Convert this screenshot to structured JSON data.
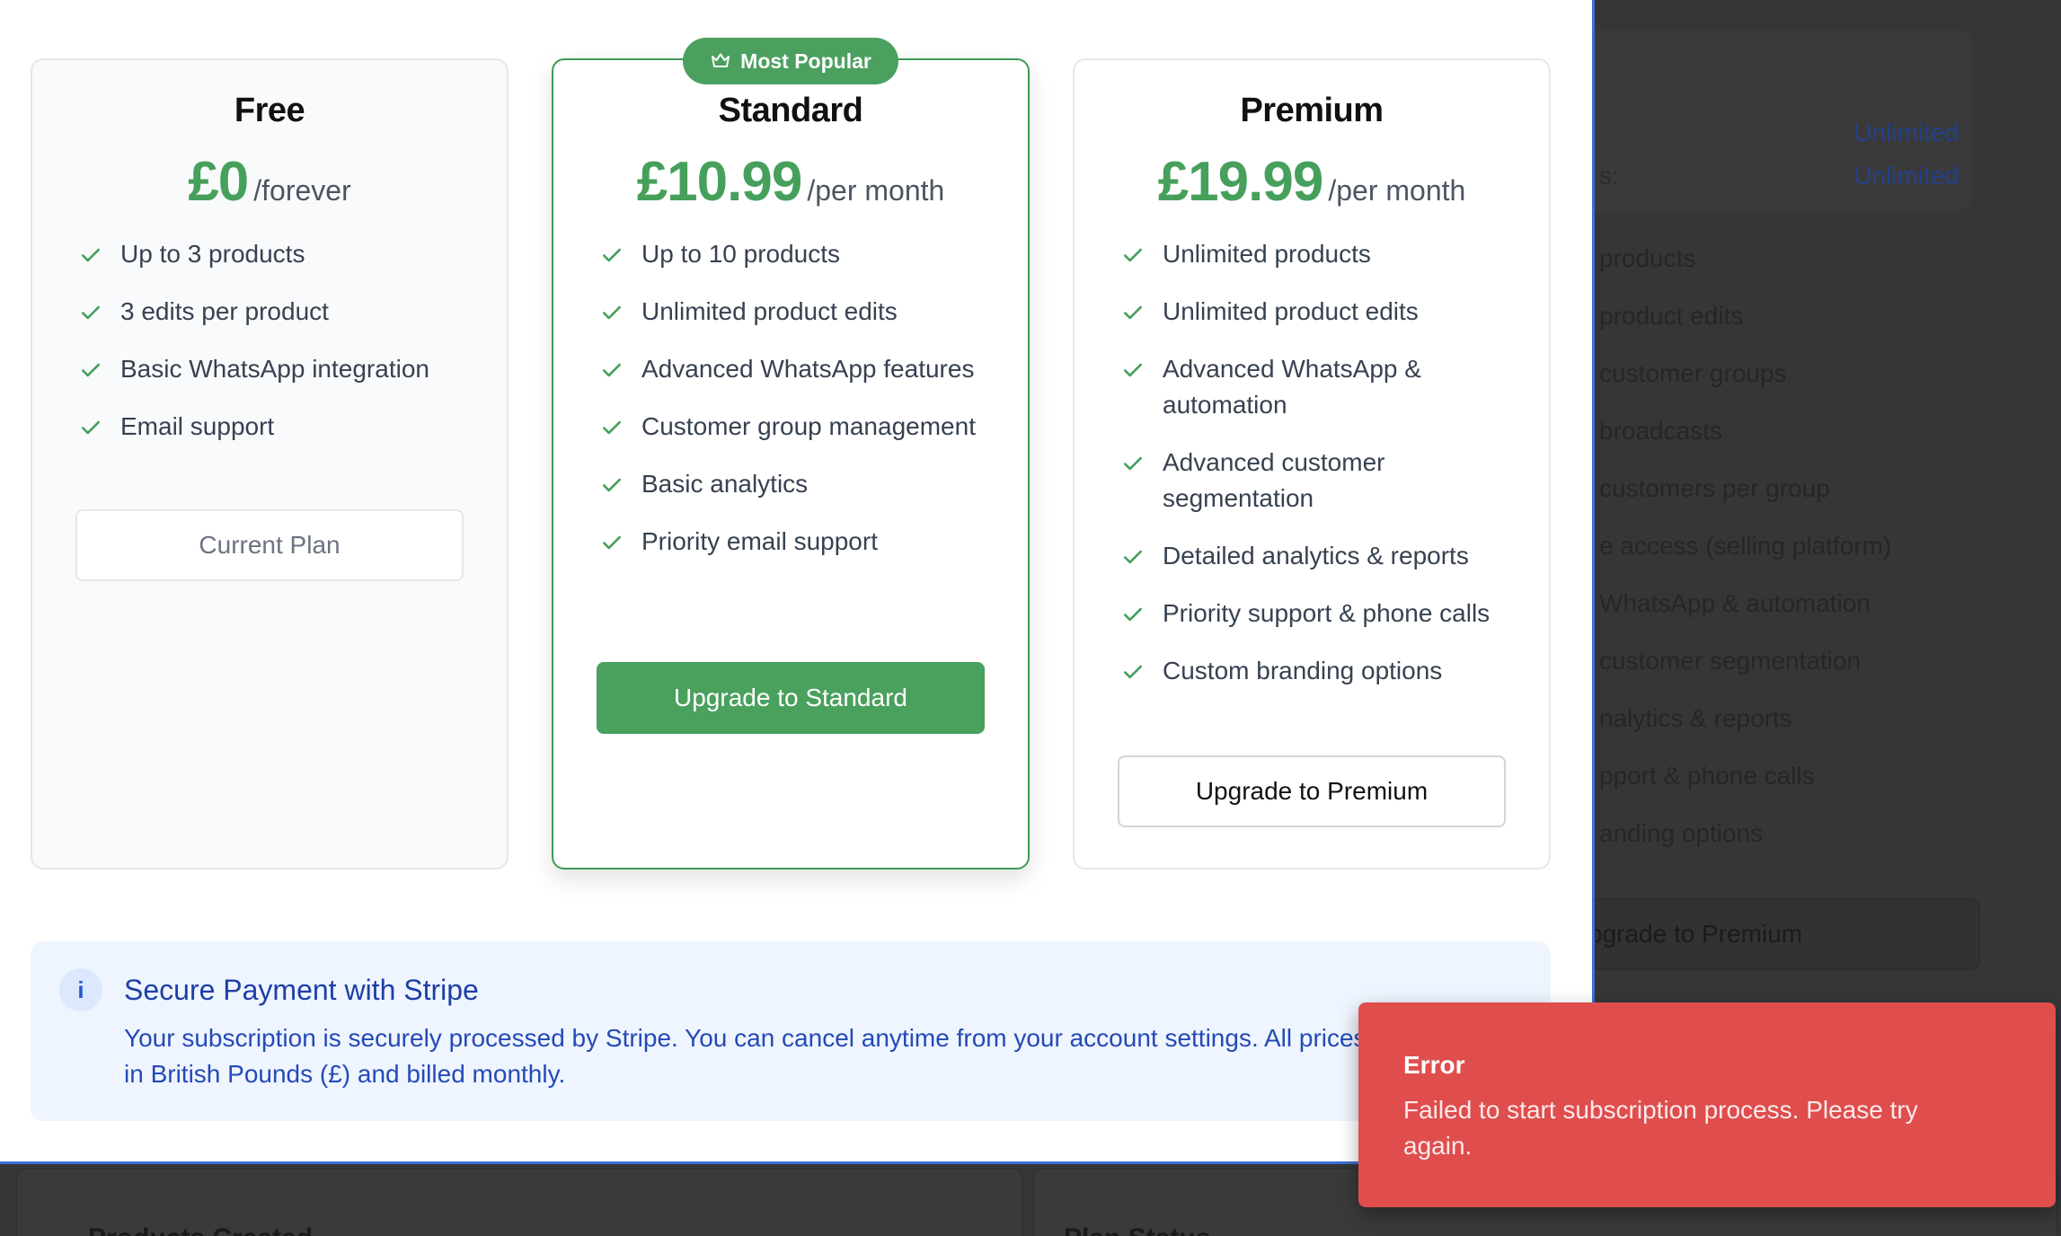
{
  "background": {
    "limits": [
      {
        "label": "",
        "value": "Unlimited"
      },
      {
        "label": "s:",
        "value": "Unlimited"
      }
    ],
    "features": [
      "products",
      "product edits",
      "customer groups",
      "broadcasts",
      "customers per group",
      "e access (selling platform)",
      "WhatsApp & automation",
      "customer segmentation",
      "nalytics & reports",
      "pport & phone calls",
      "anding options"
    ],
    "button_label": "pgrade to Premium",
    "bottom_labels": [
      "Products Created",
      "Plan Status"
    ]
  },
  "plans": {
    "free": {
      "name": "Free",
      "price": "£0",
      "period": "/forever",
      "features": [
        "Up to 3 products",
        "3 edits per product",
        "Basic WhatsApp integration",
        "Email support"
      ],
      "button": "Current Plan"
    },
    "standard": {
      "badge": "Most Popular",
      "name": "Standard",
      "price": "£10.99",
      "period": "/per month",
      "features": [
        "Up to 10 products",
        "Unlimited product edits",
        "Advanced WhatsApp features",
        "Customer group management",
        "Basic analytics",
        "Priority email support"
      ],
      "button": "Upgrade to Standard"
    },
    "premium": {
      "name": "Premium",
      "price": "£19.99",
      "period": "/per month",
      "features": [
        "Unlimited products",
        "Unlimited product edits",
        "Advanced WhatsApp & automation",
        "Advanced customer segmentation",
        "Detailed analytics & reports",
        "Priority support & phone calls",
        "Custom branding options"
      ],
      "button": "Upgrade to Premium"
    }
  },
  "info": {
    "icon": "i",
    "title": "Secure Payment with Stripe",
    "text": "Your subscription is securely processed by Stripe. You can cancel anytime from your account settings. All prices are in British Pounds (£) and billed monthly."
  },
  "toast": {
    "title": "Error",
    "message": "Failed to start subscription process. Please try again."
  },
  "colors": {
    "accent_green": "#4aa05d",
    "info_blue": "#2549b8",
    "error_red": "#df4d4d"
  }
}
